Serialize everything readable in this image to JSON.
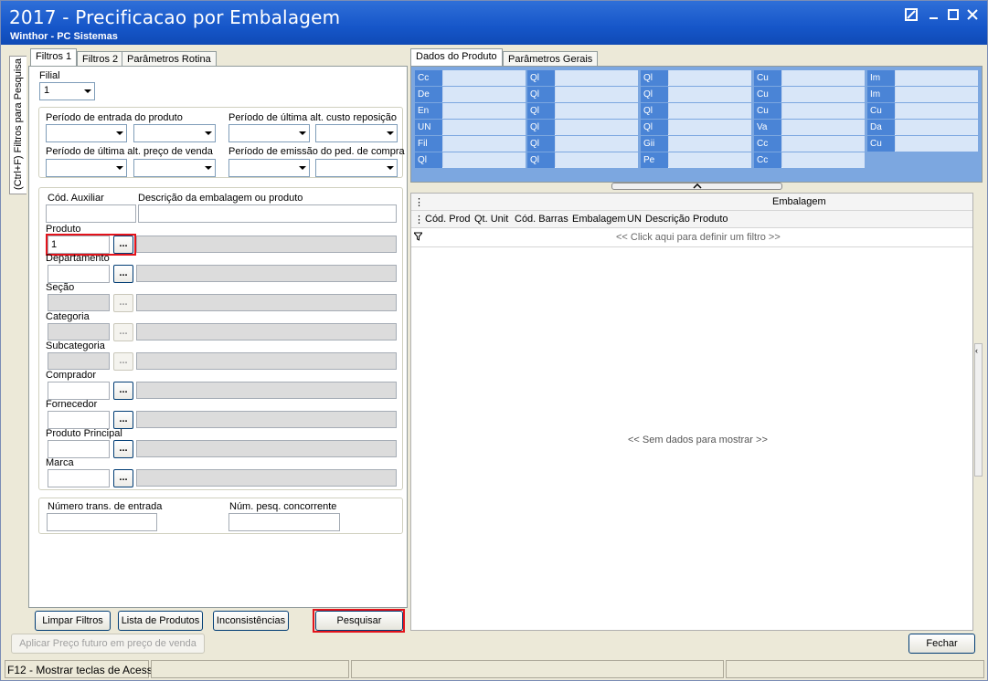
{
  "window": {
    "title": "2017 - Precificacao por Embalagem",
    "subtitle": "Winthor - PC Sistemas"
  },
  "side_tab": "(Ctrl+F) Filtros para Pesquisa",
  "left_tabs": [
    "Filtros 1",
    "Filtros 2",
    "Parâmetros Rotina"
  ],
  "filtros1": {
    "filial_label": "Filial",
    "filial_value": "1",
    "periodos": [
      "Período de entrada do produto",
      "Período de última alt. custo reposição",
      "Período de última alt. preço de venda",
      "Período de emissão do ped. de compra"
    ],
    "cod_auxiliar_label": "Cód. Auxiliar",
    "descricao_label": "Descrição da embalagem ou produto",
    "fields": [
      {
        "label": "Produto",
        "value": "1"
      },
      {
        "label": "Departamento",
        "value": ""
      },
      {
        "label": "Seção",
        "value": ""
      },
      {
        "label": "Categoria",
        "value": ""
      },
      {
        "label": "Subcategoria",
        "value": ""
      },
      {
        "label": "Comprador",
        "value": ""
      },
      {
        "label": "Fornecedor",
        "value": ""
      },
      {
        "label": "Produto Principal",
        "value": ""
      },
      {
        "label": "Marca",
        "value": ""
      }
    ],
    "dots_label": "...",
    "num_trans_label": "Número trans. de entrada",
    "num_pesq_label": "Núm. pesq. concorrente"
  },
  "left_buttons": {
    "limpar": "Limpar Filtros",
    "lista": "Lista de Produtos",
    "inconsistencias": "Inconsistências",
    "pesquisar": "Pesquisar"
  },
  "right_tabs": [
    "Dados do Produto",
    "Parâmetros Gerais"
  ],
  "product_cells": [
    [
      "Cc",
      "De",
      "En",
      "UN",
      "Fil",
      "Ql"
    ],
    [
      "Ql",
      "Ql",
      "Ql",
      "Ql",
      "Ql",
      "Ql"
    ],
    [
      "Ql",
      "Ql",
      "Ql",
      "Ql",
      "Gii",
      "Pe"
    ],
    [
      "Cu",
      "Cu",
      "Cu",
      "Va",
      "Cc",
      "Cc"
    ],
    [
      "Im",
      "Im",
      "Cu",
      "Da",
      "Cu"
    ]
  ],
  "grid": {
    "band_title": "Embalagem",
    "columns": [
      "Cód. Prod",
      "Qt. Unit",
      "Cód. Barras",
      "Embalagem",
      "UN",
      "Descrição Produto"
    ],
    "filter_hint": "<< Click aqui para definir um filtro >>",
    "empty_text": "<< Sem dados para mostrar >>"
  },
  "bottom": {
    "aplicar": "Aplicar Preço futuro em preço de venda",
    "fechar": "Fechar"
  },
  "status": {
    "hint": "F12 - Mostrar teclas de Acess"
  }
}
